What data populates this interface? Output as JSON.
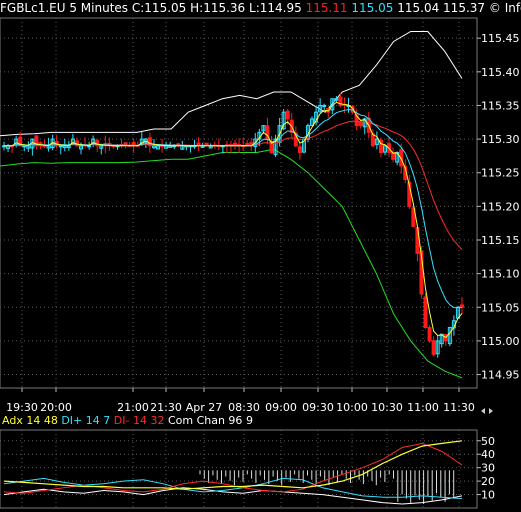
{
  "header": {
    "symbol": "FGBLc1.EU",
    "interval": "5 Minutes",
    "close": "C:115.05",
    "high": "H:115.36",
    "low": "L:114.95",
    "bid": "115.11",
    "ask": "115.05",
    "open": "115.04",
    "prev": "115.37",
    "copyright": "© Infotec SA"
  },
  "indicator_legend": {
    "adx_label": "Adx 14",
    "adx_value": "48",
    "diplus_label": "DI+ 14",
    "diplus_value": "7",
    "diminus_label": "DI- 14",
    "diminus_value": "32",
    "comchan_label": "Com Chan 96",
    "comchan_value": "9"
  },
  "colors": {
    "background": "#000000",
    "grid": "#5a5a5a",
    "up_candle": "#2fe0ff",
    "down_candle": "#ff1a1a",
    "band_upper": "#ffffff",
    "band_lower": "#22dd22",
    "ma_fast": "#ffff33",
    "ma_mid": "#33e0ff",
    "ma_slow": "#ff2a2a",
    "adx": "#ffff33",
    "di_plus": "#33e0ff",
    "di_minus": "#ff2a2a",
    "com_chan": "#ffffff"
  },
  "chart_data": [
    {
      "type": "candlestick",
      "title": "FGBLc1.EU 5 Minutes",
      "x_tick_labels": [
        "19:30",
        "20:00",
        "21:00",
        "21:30",
        "Apr 27",
        "08:30",
        "09:00",
        "09:30",
        "10:00",
        "10:30",
        "11:00",
        "11:30"
      ],
      "y_tick_labels": [
        "115.45",
        "115.40",
        "115.35",
        "115.30",
        "115.25",
        "115.20",
        "115.15",
        "115.10",
        "115.05",
        "115.00",
        "114.95"
      ],
      "ylim": [
        114.93,
        115.48
      ],
      "grid": true,
      "series": [
        {
          "name": "close",
          "values": [
            115.29,
            115.29,
            115.29,
            115.3,
            115.29,
            115.29,
            115.29,
            115.3,
            115.29,
            115.29,
            115.29,
            115.29,
            115.3,
            115.29,
            115.29,
            115.29,
            115.29,
            115.3,
            115.29,
            115.29,
            115.29,
            115.29,
            115.3,
            115.29,
            115.29,
            115.29,
            115.29,
            115.29,
            115.29,
            115.29,
            115.29,
            115.29,
            115.29,
            115.29,
            115.3,
            115.3,
            115.29,
            115.29,
            115.29,
            115.29,
            115.29,
            115.29,
            115.29,
            115.29,
            115.29,
            115.29,
            115.29,
            115.29,
            115.29,
            115.29,
            115.29,
            115.29,
            115.29,
            115.29,
            115.29,
            115.29,
            115.29,
            115.29,
            115.29,
            115.29,
            115.29,
            115.29,
            115.3,
            115.31,
            115.32,
            115.3,
            115.28,
            115.3,
            115.32,
            115.34,
            115.33,
            115.31,
            115.29,
            115.28,
            115.3,
            115.32,
            115.33,
            115.34,
            115.35,
            115.35,
            115.34,
            115.36,
            115.36,
            115.35,
            115.35,
            115.35,
            115.34,
            115.32,
            115.32,
            115.33,
            115.31,
            115.29,
            115.3,
            115.28,
            115.29,
            115.28,
            115.27,
            115.28,
            115.26,
            115.24,
            115.2,
            115.17,
            115.13,
            115.07,
            115.02,
            115.0,
            114.98,
            115.0,
            115.01,
            115.0,
            115.02,
            115.03,
            115.05,
            115.05
          ]
        },
        {
          "name": "upper-band",
          "values": [
            115.305,
            115.307,
            115.308,
            115.31,
            115.31,
            115.31,
            115.31,
            115.31,
            115.31,
            115.315,
            115.315,
            115.34,
            115.35,
            115.36,
            115.365,
            115.36,
            115.37,
            115.37,
            115.355,
            115.34,
            115.37,
            115.38,
            115.41,
            115.445,
            115.46,
            115.46,
            115.43,
            115.39
          ]
        },
        {
          "name": "lower-band",
          "values": [
            115.26,
            115.263,
            115.265,
            115.264,
            115.265,
            115.265,
            115.265,
            115.265,
            115.266,
            115.268,
            115.27,
            115.27,
            115.275,
            115.28,
            115.28,
            115.28,
            115.285,
            115.27,
            115.25,
            115.225,
            115.2,
            115.15,
            115.1,
            115.04,
            115.0,
            114.97,
            114.955,
            114.945
          ]
        }
      ]
    },
    {
      "type": "line",
      "title": "Adx 14 / DI+ 14 / DI- 14 / Com Chan 96",
      "y_tick_labels": [
        "50",
        "40",
        "30",
        "20",
        "10"
      ],
      "ylim": [
        0,
        58
      ],
      "series": [
        {
          "name": "Adx 14",
          "values": [
            20,
            19,
            18,
            17,
            16,
            16,
            15,
            15,
            15,
            14,
            15,
            16,
            16,
            17,
            16,
            15,
            17,
            20,
            25,
            33,
            40,
            46,
            48,
            50
          ]
        },
        {
          "name": "DI+ 14",
          "values": [
            18,
            20,
            22,
            19,
            17,
            18,
            20,
            21,
            18,
            14,
            12,
            13,
            15,
            18,
            22,
            21,
            15,
            12,
            9,
            8,
            8,
            9,
            8,
            7
          ]
        },
        {
          "name": "DI- 14",
          "values": [
            12,
            11,
            13,
            15,
            17,
            15,
            13,
            12,
            14,
            18,
            20,
            18,
            15,
            13,
            12,
            14,
            20,
            25,
            30,
            36,
            45,
            48,
            42,
            32
          ]
        },
        {
          "name": "Com Chan 96",
          "values": [
            10,
            12,
            14,
            12,
            11,
            13,
            12,
            10,
            13,
            15,
            14,
            12,
            11,
            13,
            12,
            11,
            10,
            8,
            6,
            4,
            3,
            4,
            6,
            9
          ]
        }
      ]
    }
  ]
}
